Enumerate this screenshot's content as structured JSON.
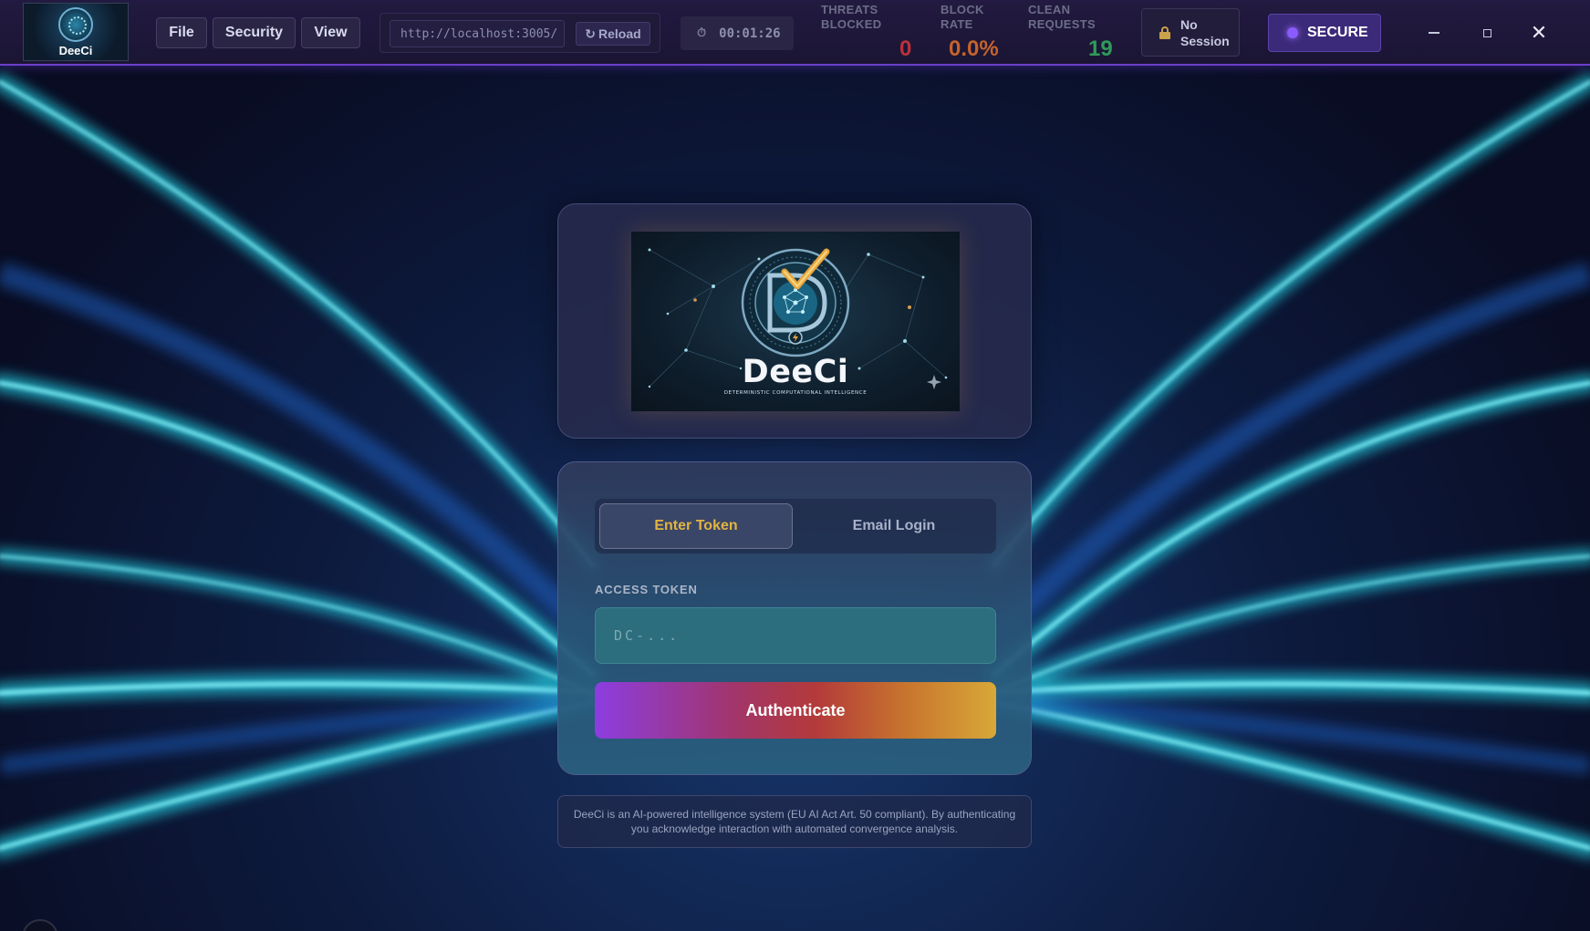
{
  "app": {
    "logo_text": "DeeCi"
  },
  "menu": {
    "file": "File",
    "security": "Security",
    "view": "View"
  },
  "address_bar": {
    "url": "http://localhost:3005/",
    "reload_label": "Reload",
    "reload_icon": "↻"
  },
  "timer": {
    "value": "00:01:26",
    "icon": "timer-icon"
  },
  "stats": {
    "threats_label_1": "THREATS",
    "threats_label_2": "BLOCKED",
    "threats_value": "0",
    "block_rate_label_1": "BLOCK",
    "block_rate_label_2": "RATE",
    "block_rate_value": "0.0%",
    "clean_label_1": "CLEAN",
    "clean_label_2": "REQUESTS",
    "clean_value": "19"
  },
  "session": {
    "line1": "No",
    "line2": "Session"
  },
  "status": {
    "secure_label": "SECURE"
  },
  "colors": {
    "accent_purple": "#6a3fc9",
    "threats_red": "#b8323a",
    "block_rate_orange": "#c5632c",
    "clean_green": "#2f9a5a",
    "active_tab_gold": "#e2b442"
  },
  "hero": {
    "name": "DeeCi",
    "tagline": "DETERMINISTIC COMPUTATIONAL INTELLIGENCE"
  },
  "login": {
    "tabs": [
      {
        "label": "Enter Token",
        "active": true
      },
      {
        "label": "Email Login",
        "active": false
      }
    ],
    "token_label": "ACCESS TOKEN",
    "token_placeholder": "DC-...",
    "token_value": "",
    "submit_label": "Authenticate"
  },
  "disclaimer": "DeeCi is an AI-powered intelligence system (EU AI Act Art. 50 compliant). By authenticating you acknowledge interaction with automated convergence analysis."
}
